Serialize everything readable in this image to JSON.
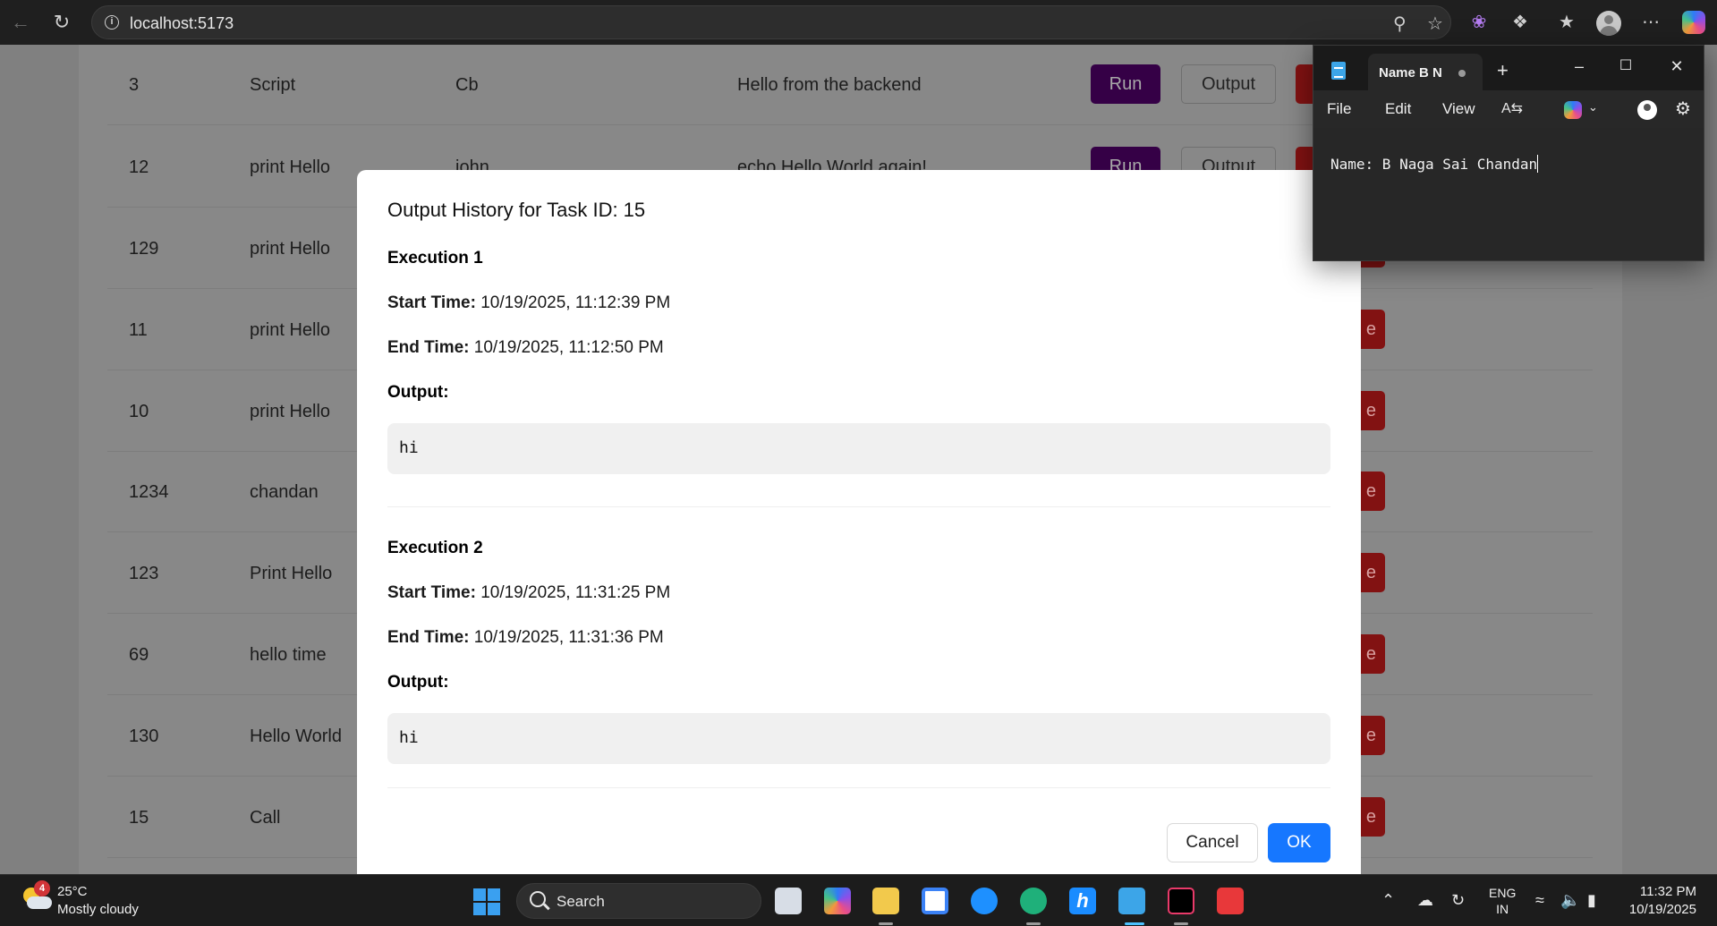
{
  "browser": {
    "url": "localhost:5173"
  },
  "tasks": [
    {
      "id": "3",
      "name": "Script",
      "owner": "Cb",
      "command": "Hello from the backend"
    },
    {
      "id": "12",
      "name": "print Hello",
      "owner": "john",
      "command": "echo Hello World again!"
    },
    {
      "id": "129",
      "name": "print Hello",
      "owner": "",
      "command": ""
    },
    {
      "id": "11",
      "name": "print Hello",
      "owner": "",
      "command": ""
    },
    {
      "id": "10",
      "name": "print Hello",
      "owner": "",
      "command": ""
    },
    {
      "id": "1234",
      "name": "chandan",
      "owner": "",
      "command": ""
    },
    {
      "id": "123",
      "name": "Print Hello",
      "owner": "",
      "command": ""
    },
    {
      "id": "69",
      "name": "hello time",
      "owner": "",
      "command": ""
    },
    {
      "id": "130",
      "name": "Hello World",
      "owner": "",
      "command": ""
    },
    {
      "id": "15",
      "name": "Call",
      "owner": "",
      "command": ""
    }
  ],
  "row_buttons": {
    "run": "Run",
    "output": "Output",
    "delete_fragment": "e"
  },
  "modal": {
    "title": "Output History for Task ID: 15",
    "executions": [
      {
        "heading": "Execution 1",
        "start_label": "Start Time:",
        "start_time": "10/19/2025, 11:12:39 PM",
        "end_label": "End Time:",
        "end_time": "10/19/2025, 11:12:50 PM",
        "output_label": "Output:",
        "output": "hi"
      },
      {
        "heading": "Execution 2",
        "start_label": "Start Time:",
        "start_time": "10/19/2025, 11:31:25 PM",
        "end_label": "End Time:",
        "end_time": "10/19/2025, 11:31:36 PM",
        "output_label": "Output:",
        "output": "hi"
      }
    ],
    "cancel_label": "Cancel",
    "ok_label": "OK"
  },
  "notepad": {
    "tab_title": "Name B N",
    "menu": [
      "File",
      "Edit",
      "View"
    ],
    "content": "Name: B Naga Sai Chandan"
  },
  "taskbar": {
    "weather_temp": "25°C",
    "weather_desc": "Mostly cloudy",
    "weather_badge": "4",
    "search_label": "Search",
    "lang_line1": "ENG",
    "lang_line2": "IN",
    "time": "11:32 PM",
    "date": "10/19/2025"
  },
  "colors": {
    "primary_button": "#1677ff",
    "run_button": "#350046",
    "delete_button": "#821212"
  }
}
